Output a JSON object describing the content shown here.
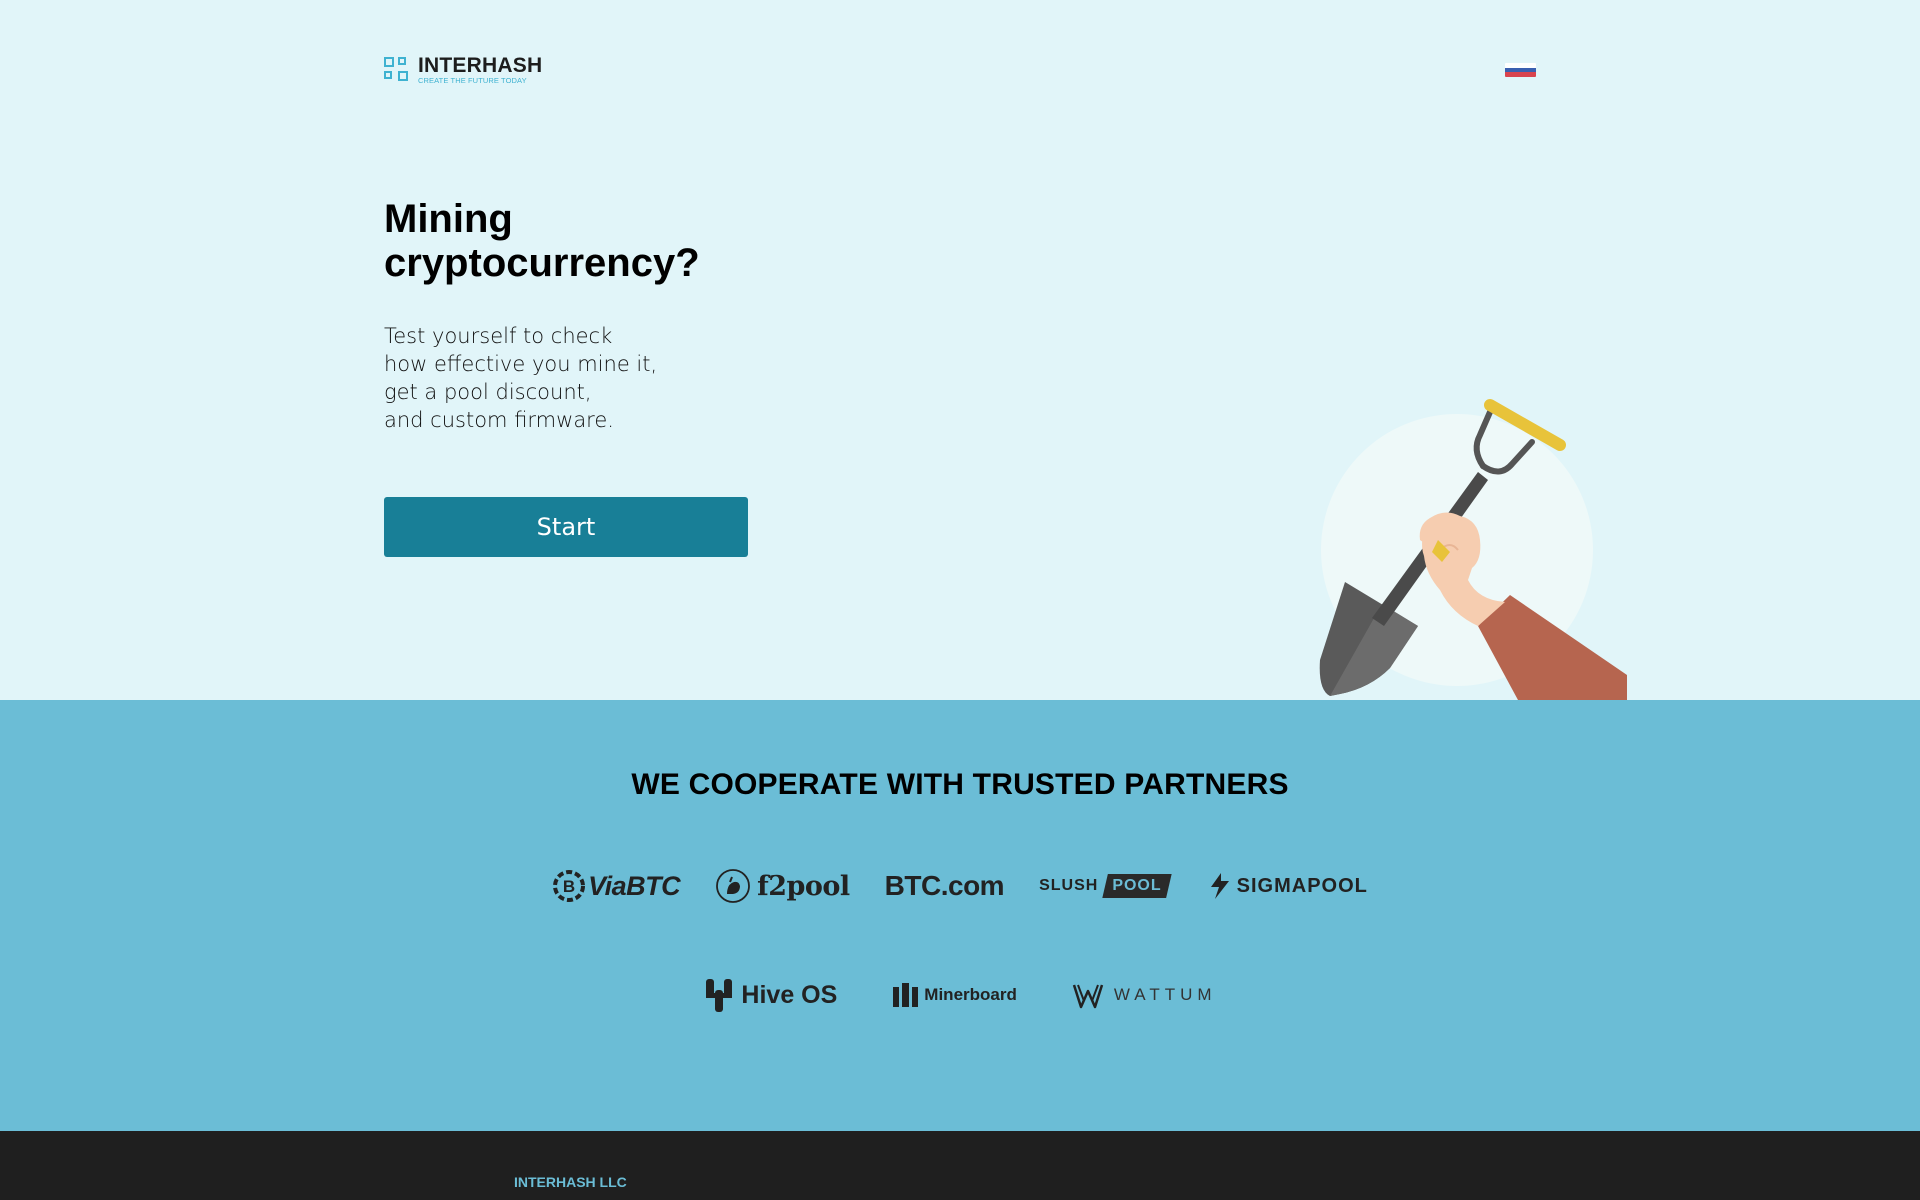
{
  "header": {
    "logo_name": "INTERHASH",
    "logo_tagline": "CREATE THE FUTURE TODAY",
    "language_flag_icon": "russian-flag-icon",
    "flag_colors": [
      "#ffffff",
      "#3a5fb0",
      "#d9434e"
    ]
  },
  "hero": {
    "headline_line1": "Mining",
    "headline_line2": "cryptocurrency?",
    "subtext_lines": [
      "Test yourself to check",
      "how effective you mine it,",
      "get a pool discount,",
      "and custom firmware."
    ],
    "start_label": "Start",
    "illustration_icon": "hand-with-shovel-illustration"
  },
  "partners": {
    "title": "WE COOPERATE WITH TRUSTED PARTNERS",
    "row1": [
      {
        "label": "ViaBTC",
        "icon": "viabtc-logo-icon"
      },
      {
        "label": "f2pool",
        "icon": "f2pool-logo-icon"
      },
      {
        "label": "BTC.com",
        "icon": "btccom-logo-icon"
      },
      {
        "label": "SLUSH",
        "label2": "POOL",
        "icon": "slushpool-logo-icon"
      },
      {
        "label": "SIGMAPOOL",
        "icon": "sigmapool-logo-icon"
      }
    ],
    "row2": [
      {
        "label": "Hive OS",
        "icon": "hiveos-logo-icon"
      },
      {
        "label": "Minerboard",
        "icon": "minerboard-logo-icon"
      },
      {
        "label": "WATTUM",
        "icon": "wattum-logo-icon"
      }
    ]
  },
  "footer": {
    "company": "INTERHASH LLC"
  },
  "colors": {
    "hero_bg": "#e1f5f9",
    "accent_button": "#187f97",
    "partners_bg": "#6bbdd6",
    "footer_bg": "#1f1f1f",
    "logo_accent": "#3fb2d1"
  }
}
